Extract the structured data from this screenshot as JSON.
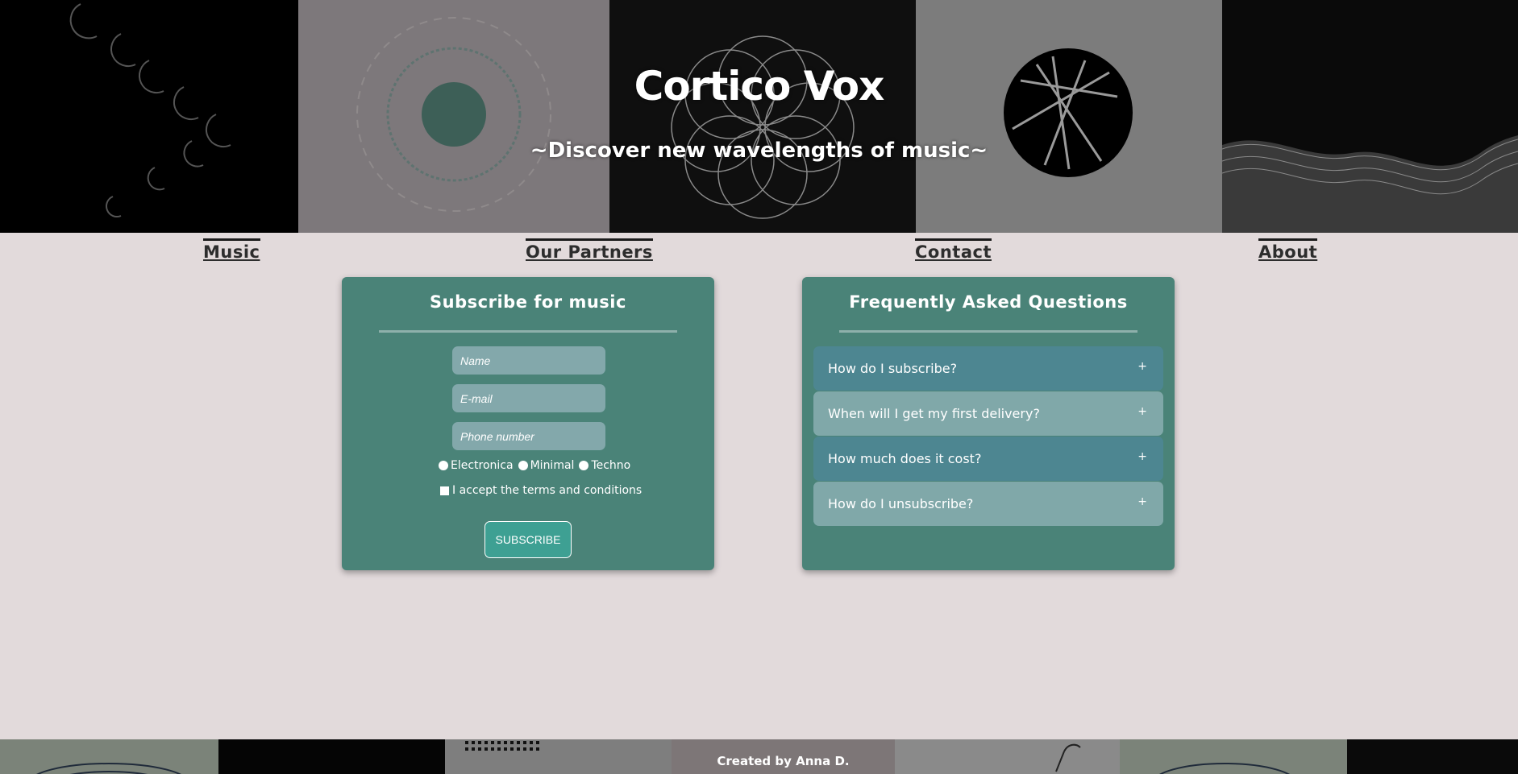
{
  "header": {
    "title": "Cortico Vox",
    "tagline": "~Discover new wavelengths of music~"
  },
  "nav": {
    "items": [
      {
        "label": "Music"
      },
      {
        "label": "Our Partners"
      },
      {
        "label": "Contact"
      },
      {
        "label": "About"
      }
    ]
  },
  "subscribe": {
    "title": "Subscribe for music",
    "name_placeholder": "Name",
    "email_placeholder": "E-mail",
    "phone_placeholder": "Phone number",
    "genres": [
      "Electronica",
      "Minimal",
      "Techno"
    ],
    "terms_label": "I accept the terms and conditions",
    "button_label": "SUBSCRIBE"
  },
  "faq": {
    "title": "Frequently Asked Questions",
    "items": [
      {
        "question": "How do I subscribe?",
        "icon": "+"
      },
      {
        "question": "When will I get my first delivery?",
        "icon": "+"
      },
      {
        "question": "How much does it cost?",
        "icon": "+"
      },
      {
        "question": "How do I unsubscribe?",
        "icon": "+"
      }
    ]
  },
  "footer": {
    "credit": "Created by Anna D."
  },
  "colors": {
    "card": "#4a8378",
    "field": "#83a8ab",
    "faq_dark": "#4d8691",
    "faq_light": "#80a8a9",
    "button": "#3ea093",
    "page_bg": "#e2dadb"
  }
}
